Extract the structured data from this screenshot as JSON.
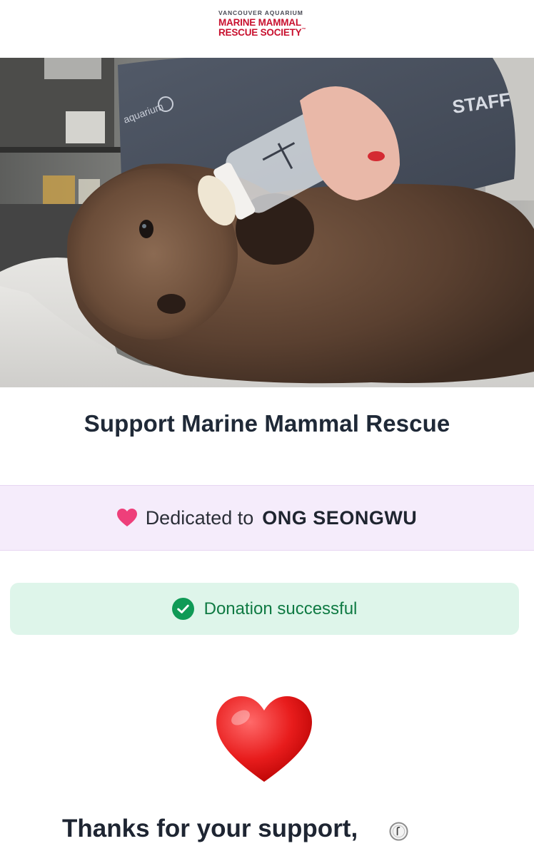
{
  "header": {
    "logo_line1": "VANCOUVER AQUARIUM",
    "logo_line2": "MARINE MAMMAL",
    "logo_line3": "RESCUE SOCIETY",
    "logo_tm": "™"
  },
  "hero": {
    "image": "sea-otter-pup-bottle-feeding-photo",
    "sleeve_text_left": "aquarium",
    "sleeve_text_right": "STAFF"
  },
  "main": {
    "title": "Support Marine Mammal Rescue"
  },
  "dedication": {
    "prefix": "Dedicated to",
    "name": "ONG SEONGWU",
    "icon": "heart-icon",
    "heart_color": "#ee3f7a",
    "background": "#f5ecfb"
  },
  "status": {
    "message": "Donation successful",
    "icon": "check-circle-icon",
    "text_color": "#0f7a43",
    "background": "#def5ea"
  },
  "thanks": {
    "heading": "Thanks for your support,",
    "icon": "heart-emoji-icon"
  },
  "colors": {
    "brand_red": "#c8102e",
    "heading": "#1f2937"
  }
}
